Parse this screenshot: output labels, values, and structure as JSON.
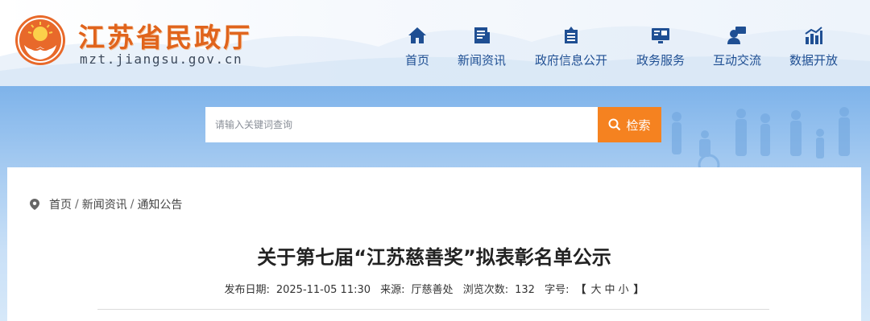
{
  "header": {
    "title": "江苏省民政厅",
    "domain": "mzt.jiangsu.gov.cn",
    "brand_color": "#e0641c"
  },
  "nav": {
    "items": [
      {
        "label": "首页",
        "icon": "home-icon"
      },
      {
        "label": "新闻资讯",
        "icon": "news-icon"
      },
      {
        "label": "政府信息公开",
        "icon": "government-info-icon"
      },
      {
        "label": "政务服务",
        "icon": "service-icon"
      },
      {
        "label": "互动交流",
        "icon": "interaction-icon"
      },
      {
        "label": "数据开放",
        "icon": "data-chart-icon"
      }
    ],
    "color": "#1f4f93"
  },
  "search": {
    "placeholder": "请输入关键词查询",
    "button_label": "检索",
    "button_color": "#f58220"
  },
  "breadcrumb": {
    "items": [
      "首页",
      "新闻资讯",
      "通知公告"
    ],
    "separator": "/"
  },
  "article": {
    "title": "关于第七届“江苏慈善奖”拟表彰名单公示",
    "meta": {
      "date_label": "发布日期:",
      "date": "2025-11-05 11:30",
      "source_label": "来源:",
      "source": "厅慈善处",
      "views_label": "浏览次数:",
      "views": "132",
      "font_label": "字号:",
      "font_open": "【",
      "font_large": "大",
      "font_medium": "中",
      "font_small": "小",
      "font_close": "】"
    }
  }
}
